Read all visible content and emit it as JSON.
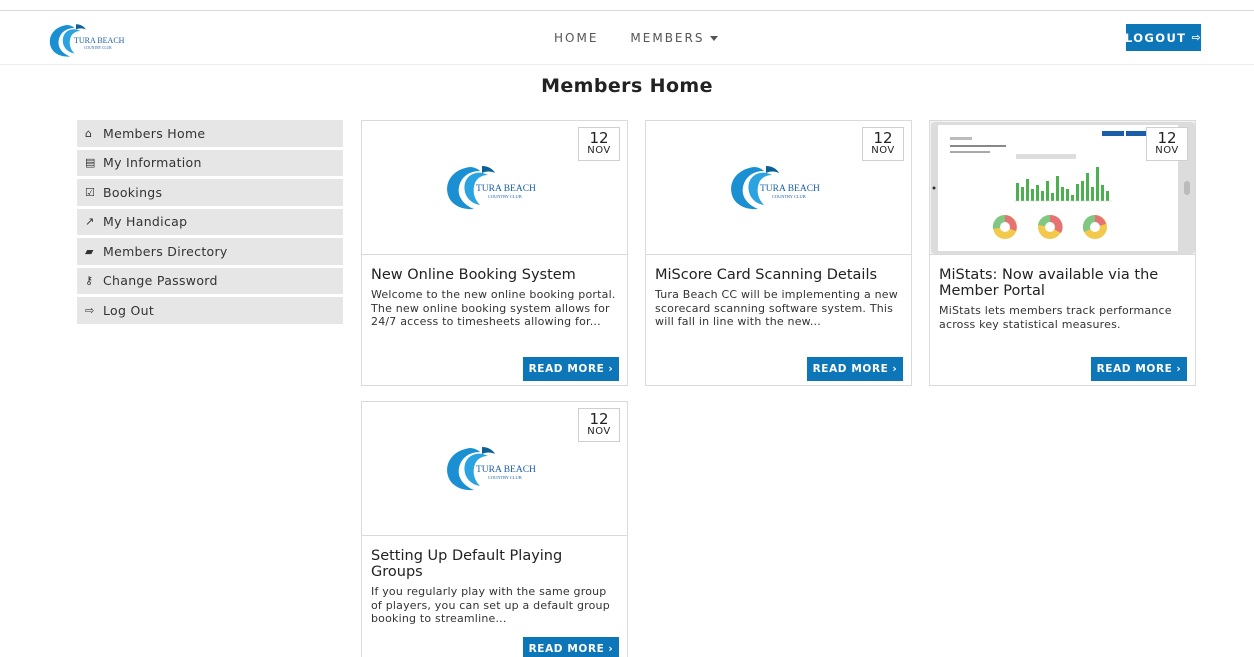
{
  "header": {
    "logo_alt": "Tura Beach Country Club",
    "logo_text_1": "TURA BEACH",
    "logo_text_2": "COUNTRY CLUB",
    "nav": {
      "home": "HOME",
      "members": "MEMBERS"
    },
    "logout_label": "LOGOUT",
    "logout_icon": "sign-out-icon"
  },
  "page_title": "Members Home",
  "sidebar": {
    "items": [
      {
        "label": "Members Home",
        "icon": "home-icon"
      },
      {
        "label": "My Information",
        "icon": "id-card-icon"
      },
      {
        "label": "Bookings",
        "icon": "calendar-check-icon"
      },
      {
        "label": "My Handicap",
        "icon": "external-link-icon"
      },
      {
        "label": "Members Directory",
        "icon": "book-icon"
      },
      {
        "label": "Change Password",
        "icon": "key-icon"
      },
      {
        "label": "Log Out",
        "icon": "sign-out-icon"
      }
    ]
  },
  "cards": [
    {
      "day": "12",
      "month": "NOV",
      "title": "New Online Booking System",
      "excerpt": "Welcome to the new online booking portal. The new online booking system allows for 24/7 access to timesheets allowing for...",
      "button": "READ MORE"
    },
    {
      "day": "12",
      "month": "NOV",
      "title": "MiScore Card Scanning Details",
      "excerpt": "Tura Beach CC will be implementing a new scorecard scanning software system. This will fall in line with the new...",
      "button": "READ MORE"
    },
    {
      "day": "12",
      "month": "NOV",
      "title": "MiStats: Now available via the Member Portal",
      "excerpt": "MiStats lets members track performance across key statistical measures.",
      "button": "READ MORE"
    },
    {
      "day": "12",
      "month": "NOV",
      "title": "Setting Up Default Playing Groups",
      "excerpt": "If you regularly play with the same group of players, you can set up a default group booking to streamline...",
      "button": "READ MORE"
    }
  ],
  "colors": {
    "accent": "#0d76b8",
    "sidebar_bg": "#e6e6e6",
    "logo_blue": "#1a8fd1"
  }
}
